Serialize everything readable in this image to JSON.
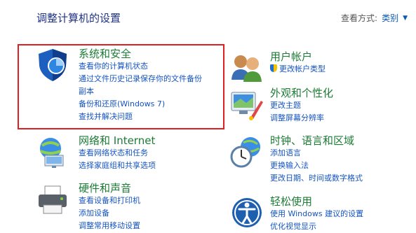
{
  "header": {
    "title": "调整计算机的设置",
    "view_by_label": "查看方式:",
    "view_by_value": "类别",
    "view_by_arrow": "▼"
  },
  "left_categories": [
    {
      "title": "系统和安全",
      "icon": "security-shield-icon",
      "links": [
        "查看你的计算机状态",
        "通过文件历史记录保存你的文件备份",
        "副本",
        "备份和还原(Windows 7)",
        "查找并解决问题"
      ]
    },
    {
      "title": "网络和 Internet",
      "icon": "network-icon",
      "links": [
        "查看网络状态和任务",
        "选择家庭组和共享选项"
      ]
    },
    {
      "title": "硬件和声音",
      "icon": "printer-icon",
      "links": [
        "查看设备和打印机",
        "添加设备",
        "调整常用移动设置"
      ]
    }
  ],
  "right_categories": [
    {
      "title": "用户帐户",
      "icon": "users-icon",
      "links": [
        "更改帐户类型"
      ]
    },
    {
      "title": "外观和个性化",
      "icon": "appearance-icon",
      "links": [
        "更改主题",
        "调整屏幕分辨率"
      ]
    },
    {
      "title": "时钟、语言和区域",
      "icon": "clock-globe-icon",
      "links": [
        "添加语言",
        "更换输入法",
        "更改日期、时间或数字格式"
      ]
    },
    {
      "title": "轻松使用",
      "icon": "ease-of-access-icon",
      "links": [
        "使用 Windows 建议的设置",
        "优化视觉显示"
      ]
    }
  ]
}
